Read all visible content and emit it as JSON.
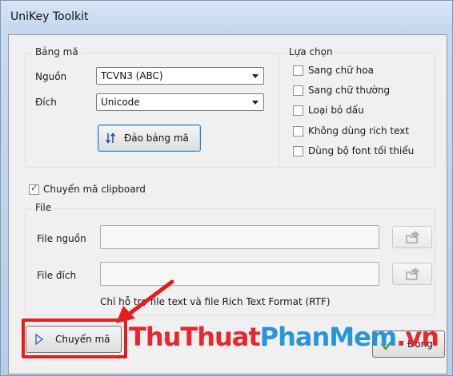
{
  "window": {
    "title": "UniKey Toolkit"
  },
  "charset": {
    "group_title": "Bảng mã",
    "source_label": "Nguồn",
    "source_value": "TCVN3 (ABC)",
    "dest_label": "Đích",
    "dest_value": "Unicode",
    "swap_button": "Đảo bảng mã"
  },
  "options": {
    "group_title": "Lựa chọn",
    "items": [
      {
        "label": "Sang chữ hoa",
        "checked": false
      },
      {
        "label": "Sang chữ thường",
        "checked": false
      },
      {
        "label": "Loại bỏ dấu",
        "checked": false
      },
      {
        "label": "Không dùng rich text",
        "checked": false
      },
      {
        "label": "Dùng bộ font tối thiểu",
        "checked": false
      }
    ]
  },
  "clipboard": {
    "label": "Chuyển mã clipboard",
    "checked": true
  },
  "file": {
    "group_title": "File",
    "source_label": "File nguồn",
    "source_value": "",
    "dest_label": "File đích",
    "dest_value": "",
    "note": "Chỉ hỗ trợ file text và file Rich Text Format (RTF)"
  },
  "buttons": {
    "convert": "Chuyển mã",
    "close": "Đóng"
  },
  "watermark": {
    "part1": "ThuThuat",
    "part2": "PhanMem",
    "part3": ".vn"
  },
  "colors": {
    "highlight": "#e41d1d",
    "watermark_red": "#e8262c",
    "watermark_blue": "#2796d9"
  }
}
